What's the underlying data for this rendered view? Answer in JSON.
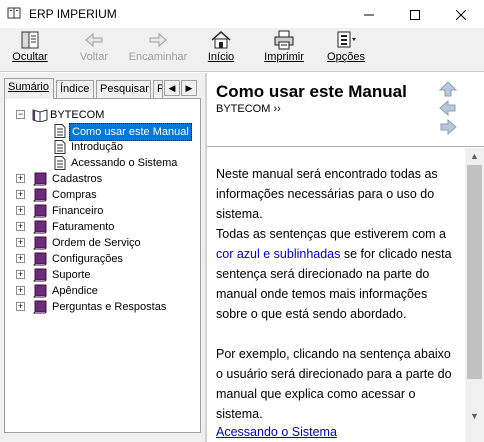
{
  "window": {
    "title": "ERP IMPERIUM",
    "icon": "help-book-icon",
    "controls": [
      "minimize-icon",
      "maximize-icon",
      "close-icon"
    ]
  },
  "toolbar": {
    "ocultar": {
      "label": "Ocultar",
      "icon": "hide-pane-icon",
      "enabled": true
    },
    "voltar": {
      "label": "Voltar",
      "icon": "back-arrow-icon",
      "enabled": false
    },
    "encaminhar": {
      "label": "Encaminhar",
      "icon": "forward-arrow-icon",
      "enabled": false
    },
    "inicio": {
      "label": "Início",
      "icon": "home-icon",
      "enabled": true
    },
    "imprimir": {
      "label": "Imprimir",
      "icon": "printer-icon",
      "enabled": true
    },
    "opcoes": {
      "label": "Opções",
      "icon": "options-icon",
      "enabled": true
    }
  },
  "tabs": {
    "sumario": "Sumário",
    "indice": "Índice",
    "pesquisar": "Pesquisar",
    "favoritos": "F",
    "active": "sumario"
  },
  "tree": {
    "root": {
      "label": "BYTECOM",
      "expanded": true,
      "children": [
        {
          "label": "Como usar este Manual",
          "selected": true
        },
        {
          "label": "Introdução",
          "selected": false
        },
        {
          "label": "Acessando o Sistema",
          "selected": false
        }
      ]
    },
    "books": [
      {
        "label": "Cadastros"
      },
      {
        "label": "Compras"
      },
      {
        "label": "Financeiro"
      },
      {
        "label": "Faturamento"
      },
      {
        "label": "Ordem de Serviço"
      },
      {
        "label": "Configurações"
      },
      {
        "label": "Suporte"
      },
      {
        "label": "Apêndice"
      },
      {
        "label": "Perguntas e Respostas"
      }
    ]
  },
  "topic": {
    "title": "Como usar este Manual",
    "breadcrumb": "BYTECOM ››",
    "para1": "Neste manual será encontrado todas as informações necessárias para o uso do sistema.",
    "para2_before": "Todas as sentenças que estiverem com a ",
    "para2_link": "cor azul e sublinhadas",
    "para2_after": " se for clicado nesta sentença será direcionado na parte do manual onde temos mais informações sobre o que está sendo abordado.",
    "para3": "Por exemplo, clicando na sentença abaixo o usuário será direcionado para a parte do manual que explica como acessar o sistema.",
    "bottom_link": "Acessando o Sistema"
  },
  "colors": {
    "selection": "#0078d7",
    "link": "#0000cc",
    "book": "#6b2a7a"
  }
}
